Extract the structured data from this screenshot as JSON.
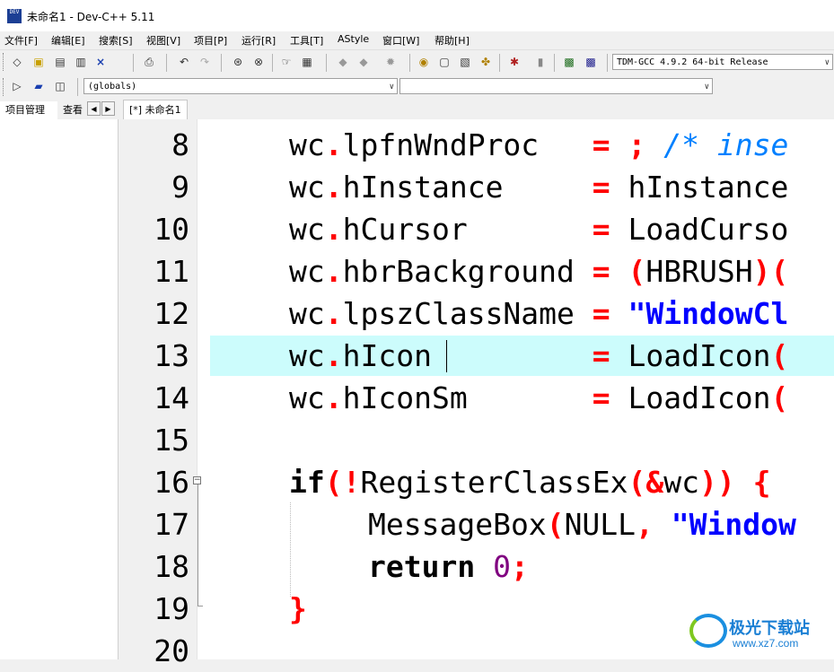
{
  "window": {
    "title": "未命名1 - Dev-C++ 5.11",
    "icon_text": "DEV"
  },
  "menu": [
    "文件[F]",
    "编辑[E]",
    "搜索[S]",
    "视图[V]",
    "项目[P]",
    "运行[R]",
    "工具[T]",
    "AStyle",
    "窗口[W]",
    "帮助[H]"
  ],
  "toolbar": {
    "compiler_select": "TDM-GCC 4.9.2 64-bit Release",
    "scope_select": "(globals)",
    "member_select": ""
  },
  "left_tabs": [
    "项目管理",
    "查看"
  ],
  "editor_tab": "[*] 未命名1",
  "lines": [
    "8",
    "9",
    "10",
    "11",
    "12",
    "13",
    "14",
    "15",
    "16",
    "17",
    "18",
    "19",
    "20"
  ],
  "code": {
    "l8": {
      "obj": "wc",
      "dot": ".",
      "field": "lpfnWndProc   ",
      "eq": "=",
      "rest": " ",
      "semi": ";",
      "cmt": " /* inse"
    },
    "l9": {
      "obj": "wc",
      "dot": ".",
      "field": "hInstance     ",
      "eq": "=",
      "rest": " hInstance"
    },
    "l10": {
      "obj": "wc",
      "dot": ".",
      "field": "hCursor       ",
      "eq": "=",
      "rest": " LoadCurso"
    },
    "l11": {
      "obj": "wc",
      "dot": ".",
      "field": "hbrBackground ",
      "eq": "=",
      "sp": " ",
      "p1": "(",
      "cast": "HBRUSH",
      "p2": ")("
    },
    "l12": {
      "obj": "wc",
      "dot": ".",
      "field": "lpszClassName ",
      "eq": "=",
      "sp": " ",
      "str": "\"WindowCl"
    },
    "l13": {
      "obj": "wc",
      "dot": ".",
      "field": "hIcon         ",
      "eq": "=",
      "rest": " LoadIcon",
      "p": "("
    },
    "l14": {
      "obj": "wc",
      "dot": ".",
      "field": "hIconSm       ",
      "eq": "=",
      "rest": " LoadIcon",
      "p": "("
    },
    "l16": {
      "kw": "if",
      "p1": "(!",
      "fn": "RegisterClassEx",
      "p2": "(&",
      "arg": "wc",
      "p3": ")) {"
    },
    "l17": {
      "fn": "MessageBox",
      "p1": "(",
      "arg": "NULL",
      "comma": ",",
      "sp": " ",
      "str": "\"Window"
    },
    "l18": {
      "kw": "return",
      "sp": " ",
      "num": "0",
      "semi": ";"
    },
    "l19": {
      "brace": "}"
    }
  },
  "watermark": {
    "text": "极光下载站",
    "url": "www.xz7.com"
  }
}
